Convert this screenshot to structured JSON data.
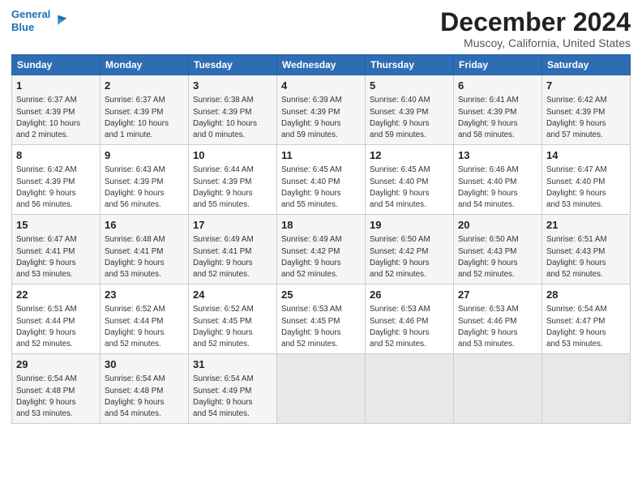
{
  "header": {
    "logo_line1": "General",
    "logo_line2": "Blue",
    "title": "December 2024",
    "subtitle": "Muscoy, California, United States"
  },
  "days_of_week": [
    "Sunday",
    "Monday",
    "Tuesday",
    "Wednesday",
    "Thursday",
    "Friday",
    "Saturday"
  ],
  "weeks": [
    [
      {
        "day": "1",
        "info": "Sunrise: 6:37 AM\nSunset: 4:39 PM\nDaylight: 10 hours\nand 2 minutes."
      },
      {
        "day": "2",
        "info": "Sunrise: 6:37 AM\nSunset: 4:39 PM\nDaylight: 10 hours\nand 1 minute."
      },
      {
        "day": "3",
        "info": "Sunrise: 6:38 AM\nSunset: 4:39 PM\nDaylight: 10 hours\nand 0 minutes."
      },
      {
        "day": "4",
        "info": "Sunrise: 6:39 AM\nSunset: 4:39 PM\nDaylight: 9 hours\nand 59 minutes."
      },
      {
        "day": "5",
        "info": "Sunrise: 6:40 AM\nSunset: 4:39 PM\nDaylight: 9 hours\nand 59 minutes."
      },
      {
        "day": "6",
        "info": "Sunrise: 6:41 AM\nSunset: 4:39 PM\nDaylight: 9 hours\nand 58 minutes."
      },
      {
        "day": "7",
        "info": "Sunrise: 6:42 AM\nSunset: 4:39 PM\nDaylight: 9 hours\nand 57 minutes."
      }
    ],
    [
      {
        "day": "8",
        "info": "Sunrise: 6:42 AM\nSunset: 4:39 PM\nDaylight: 9 hours\nand 56 minutes."
      },
      {
        "day": "9",
        "info": "Sunrise: 6:43 AM\nSunset: 4:39 PM\nDaylight: 9 hours\nand 56 minutes."
      },
      {
        "day": "10",
        "info": "Sunrise: 6:44 AM\nSunset: 4:39 PM\nDaylight: 9 hours\nand 55 minutes."
      },
      {
        "day": "11",
        "info": "Sunrise: 6:45 AM\nSunset: 4:40 PM\nDaylight: 9 hours\nand 55 minutes."
      },
      {
        "day": "12",
        "info": "Sunrise: 6:45 AM\nSunset: 4:40 PM\nDaylight: 9 hours\nand 54 minutes."
      },
      {
        "day": "13",
        "info": "Sunrise: 6:46 AM\nSunset: 4:40 PM\nDaylight: 9 hours\nand 54 minutes."
      },
      {
        "day": "14",
        "info": "Sunrise: 6:47 AM\nSunset: 4:40 PM\nDaylight: 9 hours\nand 53 minutes."
      }
    ],
    [
      {
        "day": "15",
        "info": "Sunrise: 6:47 AM\nSunset: 4:41 PM\nDaylight: 9 hours\nand 53 minutes."
      },
      {
        "day": "16",
        "info": "Sunrise: 6:48 AM\nSunset: 4:41 PM\nDaylight: 9 hours\nand 53 minutes."
      },
      {
        "day": "17",
        "info": "Sunrise: 6:49 AM\nSunset: 4:41 PM\nDaylight: 9 hours\nand 52 minutes."
      },
      {
        "day": "18",
        "info": "Sunrise: 6:49 AM\nSunset: 4:42 PM\nDaylight: 9 hours\nand 52 minutes."
      },
      {
        "day": "19",
        "info": "Sunrise: 6:50 AM\nSunset: 4:42 PM\nDaylight: 9 hours\nand 52 minutes."
      },
      {
        "day": "20",
        "info": "Sunrise: 6:50 AM\nSunset: 4:43 PM\nDaylight: 9 hours\nand 52 minutes."
      },
      {
        "day": "21",
        "info": "Sunrise: 6:51 AM\nSunset: 4:43 PM\nDaylight: 9 hours\nand 52 minutes."
      }
    ],
    [
      {
        "day": "22",
        "info": "Sunrise: 6:51 AM\nSunset: 4:44 PM\nDaylight: 9 hours\nand 52 minutes."
      },
      {
        "day": "23",
        "info": "Sunrise: 6:52 AM\nSunset: 4:44 PM\nDaylight: 9 hours\nand 52 minutes."
      },
      {
        "day": "24",
        "info": "Sunrise: 6:52 AM\nSunset: 4:45 PM\nDaylight: 9 hours\nand 52 minutes."
      },
      {
        "day": "25",
        "info": "Sunrise: 6:53 AM\nSunset: 4:45 PM\nDaylight: 9 hours\nand 52 minutes."
      },
      {
        "day": "26",
        "info": "Sunrise: 6:53 AM\nSunset: 4:46 PM\nDaylight: 9 hours\nand 52 minutes."
      },
      {
        "day": "27",
        "info": "Sunrise: 6:53 AM\nSunset: 4:46 PM\nDaylight: 9 hours\nand 53 minutes."
      },
      {
        "day": "28",
        "info": "Sunrise: 6:54 AM\nSunset: 4:47 PM\nDaylight: 9 hours\nand 53 minutes."
      }
    ],
    [
      {
        "day": "29",
        "info": "Sunrise: 6:54 AM\nSunset: 4:48 PM\nDaylight: 9 hours\nand 53 minutes."
      },
      {
        "day": "30",
        "info": "Sunrise: 6:54 AM\nSunset: 4:48 PM\nDaylight: 9 hours\nand 54 minutes."
      },
      {
        "day": "31",
        "info": "Sunrise: 6:54 AM\nSunset: 4:49 PM\nDaylight: 9 hours\nand 54 minutes."
      },
      {
        "day": "",
        "info": ""
      },
      {
        "day": "",
        "info": ""
      },
      {
        "day": "",
        "info": ""
      },
      {
        "day": "",
        "info": ""
      }
    ]
  ]
}
